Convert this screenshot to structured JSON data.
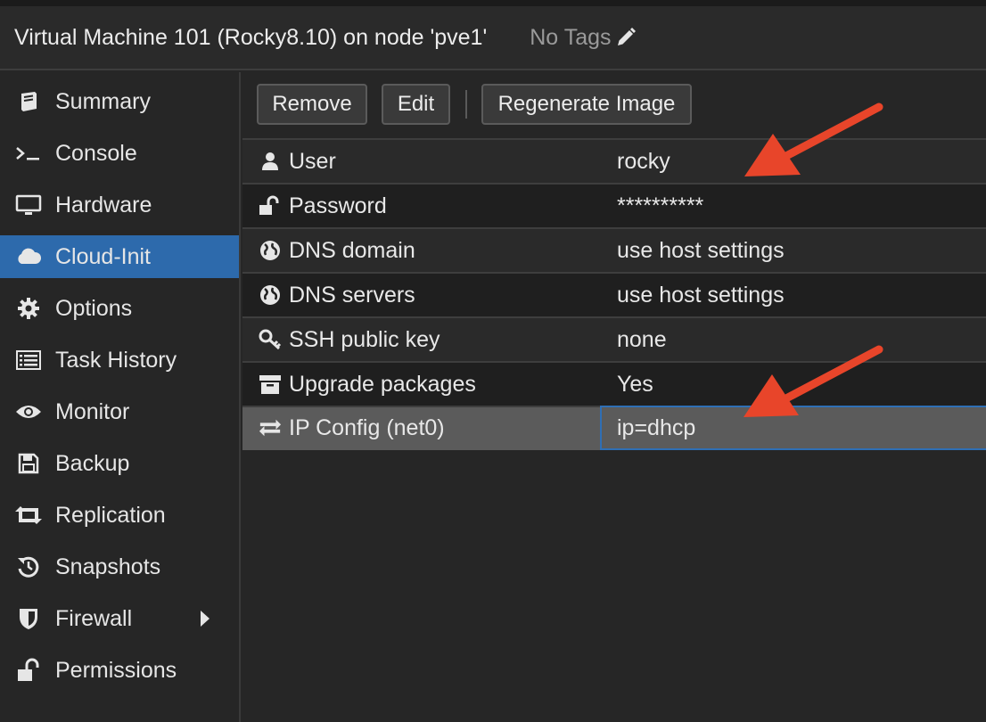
{
  "header": {
    "title": "Virtual Machine 101 (Rocky8.10) on node 'pve1'",
    "tags_label": "No Tags"
  },
  "sidebar": {
    "items": [
      {
        "label": "Summary",
        "icon": "book-icon"
      },
      {
        "label": "Console",
        "icon": "terminal-icon"
      },
      {
        "label": "Hardware",
        "icon": "monitor-icon"
      },
      {
        "label": "Cloud-Init",
        "icon": "cloud-icon"
      },
      {
        "label": "Options",
        "icon": "gear-icon"
      },
      {
        "label": "Task History",
        "icon": "list-icon"
      },
      {
        "label": "Monitor",
        "icon": "eye-icon"
      },
      {
        "label": "Backup",
        "icon": "floppy-icon"
      },
      {
        "label": "Replication",
        "icon": "retweet-icon"
      },
      {
        "label": "Snapshots",
        "icon": "history-icon"
      },
      {
        "label": "Firewall",
        "icon": "shield-icon"
      },
      {
        "label": "Permissions",
        "icon": "unlock-icon"
      }
    ],
    "active": "Cloud-Init"
  },
  "toolbar": {
    "remove_label": "Remove",
    "edit_label": "Edit",
    "regenerate_label": "Regenerate Image"
  },
  "grid": {
    "rows": [
      {
        "name": "User",
        "value": "rocky",
        "icon": "user-icon"
      },
      {
        "name": "Password",
        "value": "**********",
        "icon": "unlock-icon"
      },
      {
        "name": "DNS domain",
        "value": "use host settings",
        "icon": "globe-icon"
      },
      {
        "name": "DNS servers",
        "value": "use host settings",
        "icon": "globe-icon"
      },
      {
        "name": "SSH public key",
        "value": "none",
        "icon": "key-icon"
      },
      {
        "name": "Upgrade packages",
        "value": "Yes",
        "icon": "archive-icon"
      },
      {
        "name": "IP Config (net0)",
        "value": "ip=dhcp",
        "icon": "exchange-icon"
      }
    ],
    "selected": "IP Config (net0)"
  },
  "colors": {
    "accent": "#2d6aac",
    "annotation_arrow": "#e8452a"
  }
}
